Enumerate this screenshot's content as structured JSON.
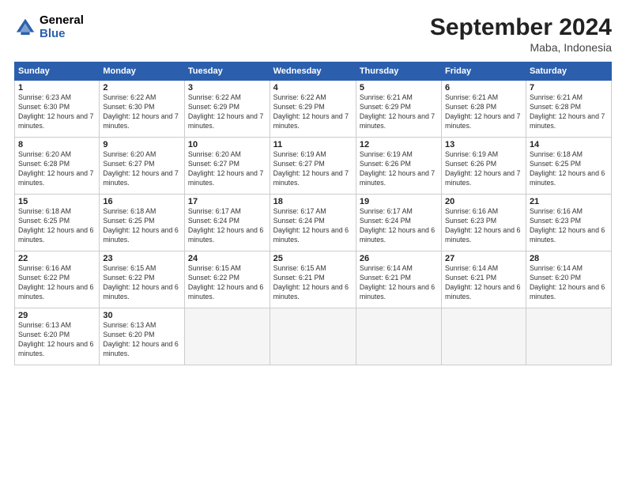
{
  "header": {
    "logo_general": "General",
    "logo_blue": "Blue",
    "month_title": "September 2024",
    "subtitle": "Maba, Indonesia"
  },
  "weekdays": [
    "Sunday",
    "Monday",
    "Tuesday",
    "Wednesday",
    "Thursday",
    "Friday",
    "Saturday"
  ],
  "weeks": [
    [
      {
        "day": "1",
        "sunrise": "Sunrise: 6:23 AM",
        "sunset": "Sunset: 6:30 PM",
        "daylight": "Daylight: 12 hours and 7 minutes."
      },
      {
        "day": "2",
        "sunrise": "Sunrise: 6:22 AM",
        "sunset": "Sunset: 6:30 PM",
        "daylight": "Daylight: 12 hours and 7 minutes."
      },
      {
        "day": "3",
        "sunrise": "Sunrise: 6:22 AM",
        "sunset": "Sunset: 6:29 PM",
        "daylight": "Daylight: 12 hours and 7 minutes."
      },
      {
        "day": "4",
        "sunrise": "Sunrise: 6:22 AM",
        "sunset": "Sunset: 6:29 PM",
        "daylight": "Daylight: 12 hours and 7 minutes."
      },
      {
        "day": "5",
        "sunrise": "Sunrise: 6:21 AM",
        "sunset": "Sunset: 6:29 PM",
        "daylight": "Daylight: 12 hours and 7 minutes."
      },
      {
        "day": "6",
        "sunrise": "Sunrise: 6:21 AM",
        "sunset": "Sunset: 6:28 PM",
        "daylight": "Daylight: 12 hours and 7 minutes."
      },
      {
        "day": "7",
        "sunrise": "Sunrise: 6:21 AM",
        "sunset": "Sunset: 6:28 PM",
        "daylight": "Daylight: 12 hours and 7 minutes."
      }
    ],
    [
      {
        "day": "8",
        "sunrise": "Sunrise: 6:20 AM",
        "sunset": "Sunset: 6:28 PM",
        "daylight": "Daylight: 12 hours and 7 minutes."
      },
      {
        "day": "9",
        "sunrise": "Sunrise: 6:20 AM",
        "sunset": "Sunset: 6:27 PM",
        "daylight": "Daylight: 12 hours and 7 minutes."
      },
      {
        "day": "10",
        "sunrise": "Sunrise: 6:20 AM",
        "sunset": "Sunset: 6:27 PM",
        "daylight": "Daylight: 12 hours and 7 minutes."
      },
      {
        "day": "11",
        "sunrise": "Sunrise: 6:19 AM",
        "sunset": "Sunset: 6:27 PM",
        "daylight": "Daylight: 12 hours and 7 minutes."
      },
      {
        "day": "12",
        "sunrise": "Sunrise: 6:19 AM",
        "sunset": "Sunset: 6:26 PM",
        "daylight": "Daylight: 12 hours and 7 minutes."
      },
      {
        "day": "13",
        "sunrise": "Sunrise: 6:19 AM",
        "sunset": "Sunset: 6:26 PM",
        "daylight": "Daylight: 12 hours and 7 minutes."
      },
      {
        "day": "14",
        "sunrise": "Sunrise: 6:18 AM",
        "sunset": "Sunset: 6:25 PM",
        "daylight": "Daylight: 12 hours and 6 minutes."
      }
    ],
    [
      {
        "day": "15",
        "sunrise": "Sunrise: 6:18 AM",
        "sunset": "Sunset: 6:25 PM",
        "daylight": "Daylight: 12 hours and 6 minutes."
      },
      {
        "day": "16",
        "sunrise": "Sunrise: 6:18 AM",
        "sunset": "Sunset: 6:25 PM",
        "daylight": "Daylight: 12 hours and 6 minutes."
      },
      {
        "day": "17",
        "sunrise": "Sunrise: 6:17 AM",
        "sunset": "Sunset: 6:24 PM",
        "daylight": "Daylight: 12 hours and 6 minutes."
      },
      {
        "day": "18",
        "sunrise": "Sunrise: 6:17 AM",
        "sunset": "Sunset: 6:24 PM",
        "daylight": "Daylight: 12 hours and 6 minutes."
      },
      {
        "day": "19",
        "sunrise": "Sunrise: 6:17 AM",
        "sunset": "Sunset: 6:24 PM",
        "daylight": "Daylight: 12 hours and 6 minutes."
      },
      {
        "day": "20",
        "sunrise": "Sunrise: 6:16 AM",
        "sunset": "Sunset: 6:23 PM",
        "daylight": "Daylight: 12 hours and 6 minutes."
      },
      {
        "day": "21",
        "sunrise": "Sunrise: 6:16 AM",
        "sunset": "Sunset: 6:23 PM",
        "daylight": "Daylight: 12 hours and 6 minutes."
      }
    ],
    [
      {
        "day": "22",
        "sunrise": "Sunrise: 6:16 AM",
        "sunset": "Sunset: 6:22 PM",
        "daylight": "Daylight: 12 hours and 6 minutes."
      },
      {
        "day": "23",
        "sunrise": "Sunrise: 6:15 AM",
        "sunset": "Sunset: 6:22 PM",
        "daylight": "Daylight: 12 hours and 6 minutes."
      },
      {
        "day": "24",
        "sunrise": "Sunrise: 6:15 AM",
        "sunset": "Sunset: 6:22 PM",
        "daylight": "Daylight: 12 hours and 6 minutes."
      },
      {
        "day": "25",
        "sunrise": "Sunrise: 6:15 AM",
        "sunset": "Sunset: 6:21 PM",
        "daylight": "Daylight: 12 hours and 6 minutes."
      },
      {
        "day": "26",
        "sunrise": "Sunrise: 6:14 AM",
        "sunset": "Sunset: 6:21 PM",
        "daylight": "Daylight: 12 hours and 6 minutes."
      },
      {
        "day": "27",
        "sunrise": "Sunrise: 6:14 AM",
        "sunset": "Sunset: 6:21 PM",
        "daylight": "Daylight: 12 hours and 6 minutes."
      },
      {
        "day": "28",
        "sunrise": "Sunrise: 6:14 AM",
        "sunset": "Sunset: 6:20 PM",
        "daylight": "Daylight: 12 hours and 6 minutes."
      }
    ],
    [
      {
        "day": "29",
        "sunrise": "Sunrise: 6:13 AM",
        "sunset": "Sunset: 6:20 PM",
        "daylight": "Daylight: 12 hours and 6 minutes."
      },
      {
        "day": "30",
        "sunrise": "Sunrise: 6:13 AM",
        "sunset": "Sunset: 6:20 PM",
        "daylight": "Daylight: 12 hours and 6 minutes."
      },
      {
        "day": "",
        "sunrise": "",
        "sunset": "",
        "daylight": ""
      },
      {
        "day": "",
        "sunrise": "",
        "sunset": "",
        "daylight": ""
      },
      {
        "day": "",
        "sunrise": "",
        "sunset": "",
        "daylight": ""
      },
      {
        "day": "",
        "sunrise": "",
        "sunset": "",
        "daylight": ""
      },
      {
        "day": "",
        "sunrise": "",
        "sunset": "",
        "daylight": ""
      }
    ]
  ]
}
